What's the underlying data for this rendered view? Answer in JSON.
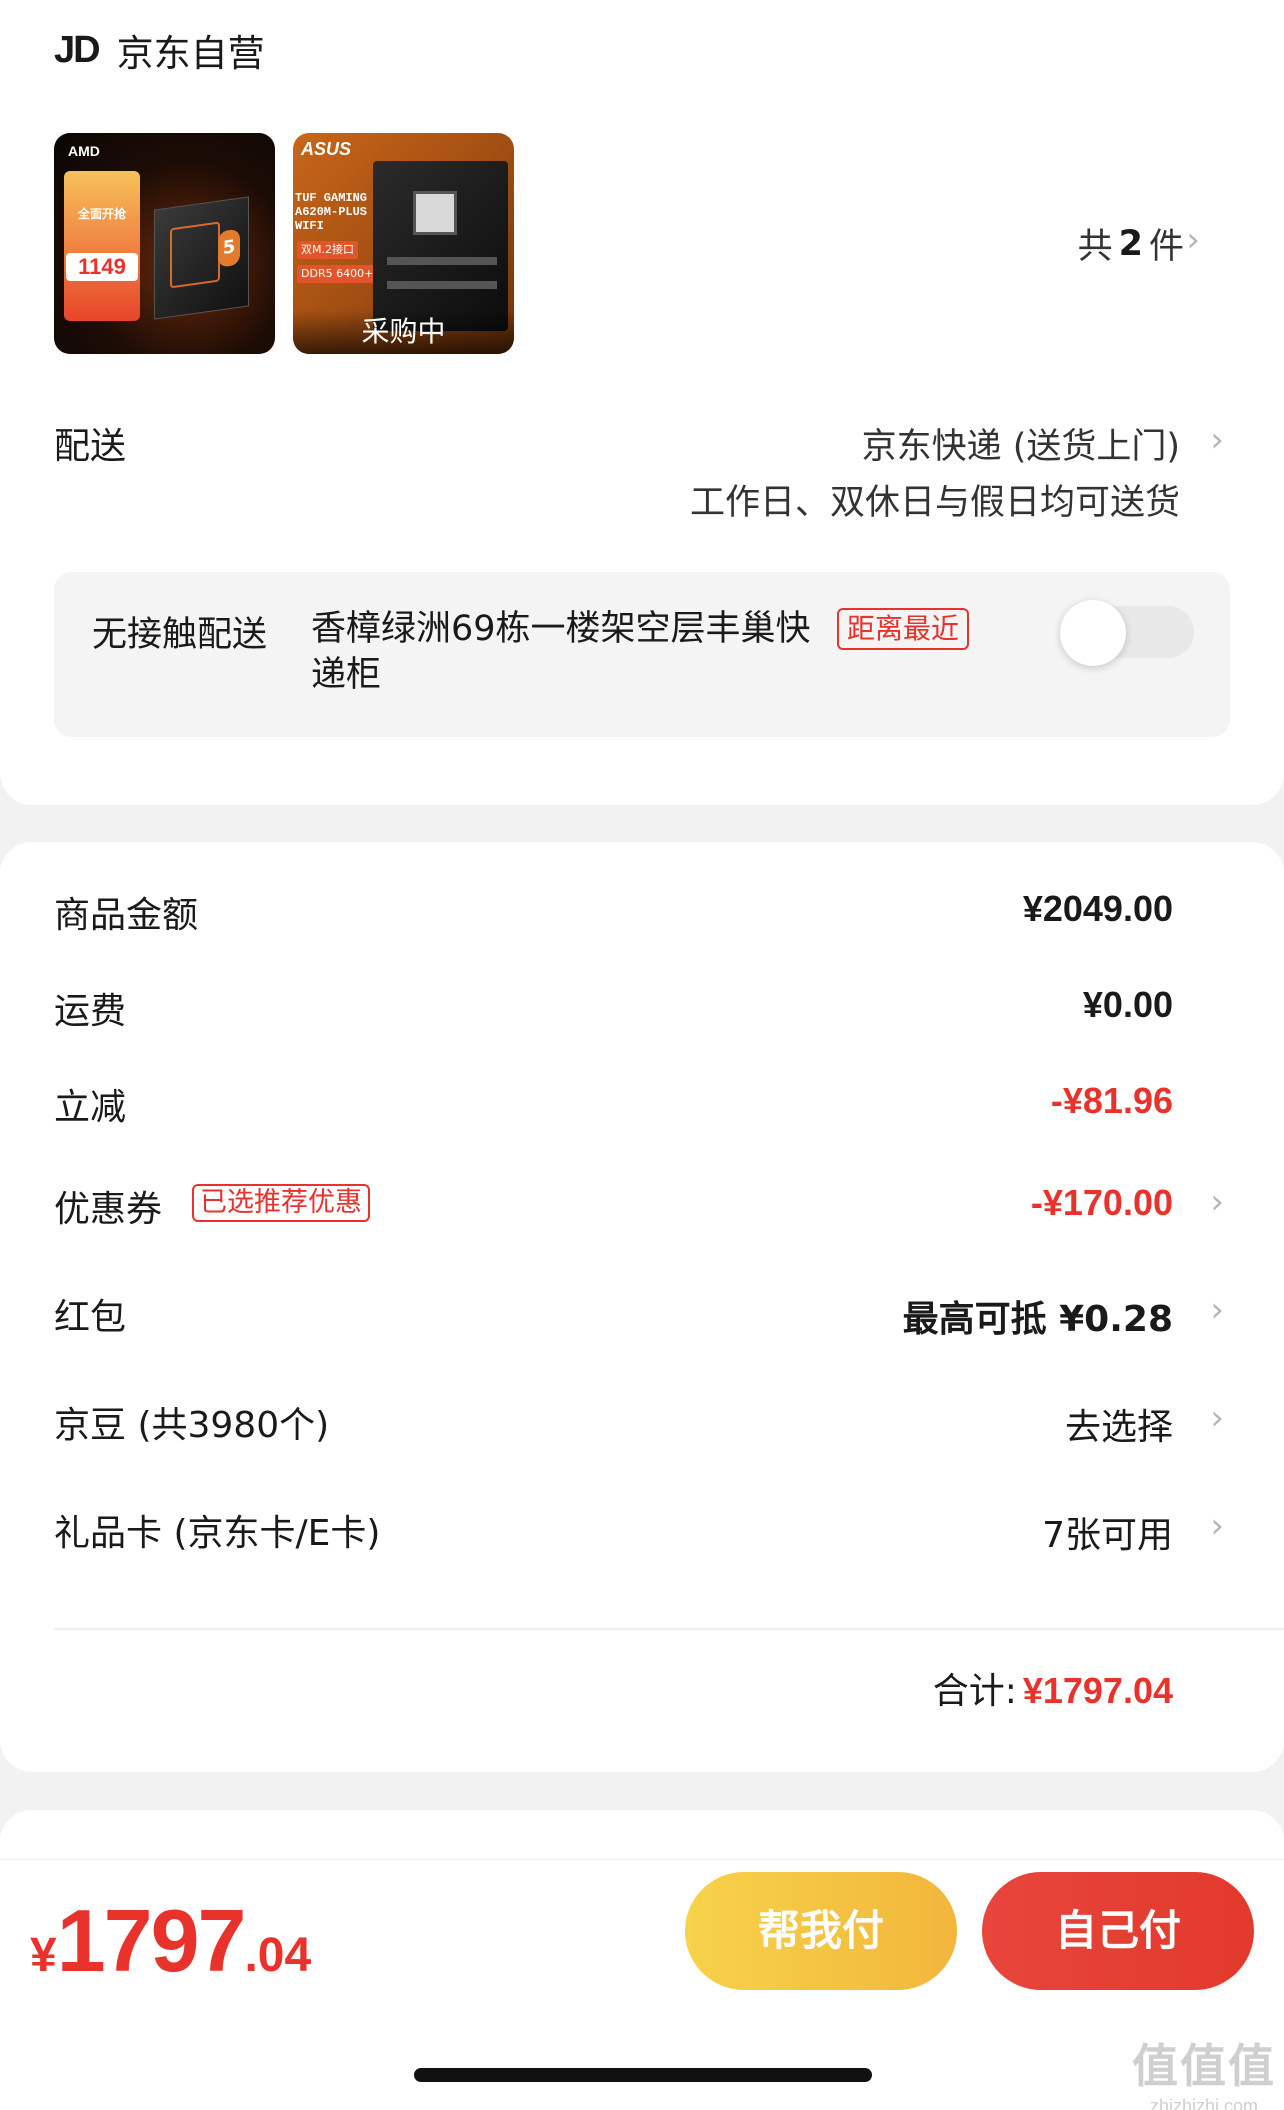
{
  "shop": {
    "logo": "JD",
    "name": "京东自营"
  },
  "products": {
    "thumb1": {
      "brand": "AMD",
      "promo_title": "全面开抢",
      "price": "1149"
    },
    "thumb2": {
      "brand": "ASUS",
      "model_lines": [
        "TUF GAMING",
        "A620M-PLUS",
        "WIFI"
      ],
      "chip1": "双M.2接口",
      "chip2": "DDR5 6400+",
      "overlay": "采购中"
    },
    "count_prefix": "共",
    "count": "2",
    "count_suffix": "件"
  },
  "delivery": {
    "label": "配送",
    "method": "京东快递 (送货上门)",
    "schedule": "工作日、双休日与假日均可送货"
  },
  "contactless": {
    "label": "无接触配送",
    "address": "香樟绿洲69栋一楼架空层丰巢快递柜",
    "badge": "距离最近",
    "enabled": false
  },
  "summary": {
    "goods": {
      "label": "商品金额",
      "value": "¥2049.00"
    },
    "shipping": {
      "label": "运费",
      "value": "¥0.00"
    },
    "instant_discount": {
      "label": "立减",
      "value": "-¥81.96"
    },
    "coupon": {
      "label": "优惠券",
      "badge": "已选推荐优惠",
      "value": "-¥170.00"
    },
    "red_packet": {
      "label": "红包",
      "value": "最高可抵 ¥0.28"
    },
    "jd_beans": {
      "label": "京豆 (共3980个)",
      "value": "去选择"
    },
    "gift_card": {
      "label": "礼品卡 (京东卡/E卡)",
      "value": "7张可用"
    },
    "total_label": "合计:",
    "total_value": "¥1797.04"
  },
  "checkout": {
    "currency": "¥",
    "amount_int": "1797",
    "amount_dec": ".04",
    "help_pay": "帮我付",
    "self_pay": "自己付"
  },
  "watermark": {
    "text": "值值值",
    "url": "zhizhizhi.com"
  },
  "colors": {
    "accent_red": "#e8322b",
    "help_yellow": "#f2b63c",
    "background": "#f2f2f2"
  }
}
